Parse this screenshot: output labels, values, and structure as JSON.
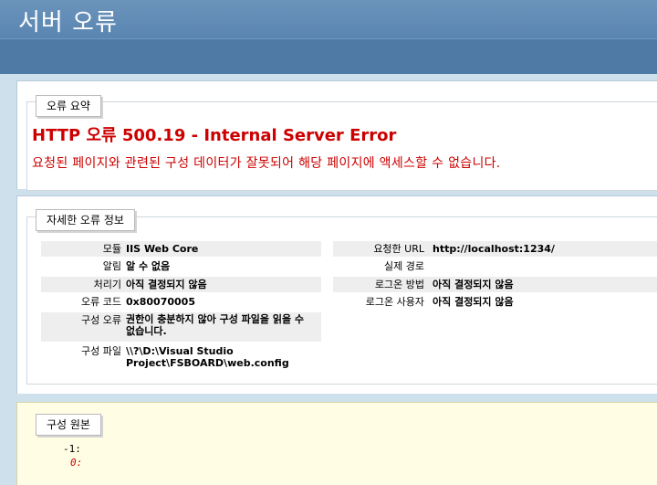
{
  "header": {
    "title": "서버 오류"
  },
  "summary": {
    "tab_label": "오류 요약",
    "error_title": "HTTP 오류 500.19 - Internal Server Error",
    "error_description": "요청된 페이지와 관련된 구성 데이터가 잘못되어 해당 페이지에 액세스할 수 없습니다."
  },
  "detail": {
    "tab_label": "자세한 오류 정보",
    "left_rows": [
      {
        "label": "모듈",
        "value": "IIS Web Core"
      },
      {
        "label": "알림",
        "value": "알 수 없음"
      },
      {
        "label": "처리기",
        "value": "아직 결정되지 않음"
      },
      {
        "label": "오류 코드",
        "value": "0x80070005"
      },
      {
        "label": "구성 오류",
        "value": "권한이 충분하지 않아 구성 파일을 읽을 수 없습니다."
      },
      {
        "label": "구성 파일",
        "value": "\\\\?\\D:\\Visual Studio Project\\FSBOARD\\web.config"
      }
    ],
    "right_rows": [
      {
        "label": "요청한 URL",
        "value": "http://localhost:1234/"
      },
      {
        "label": "실제 경로",
        "value": ""
      },
      {
        "label": "로그온 방법",
        "value": "아직 결정되지 않음"
      },
      {
        "label": "로그온 사용자",
        "value": "아직 결정되지 않음"
      }
    ]
  },
  "source": {
    "tab_label": "구성 원본",
    "line1": "-1:",
    "line2": "0:"
  }
}
